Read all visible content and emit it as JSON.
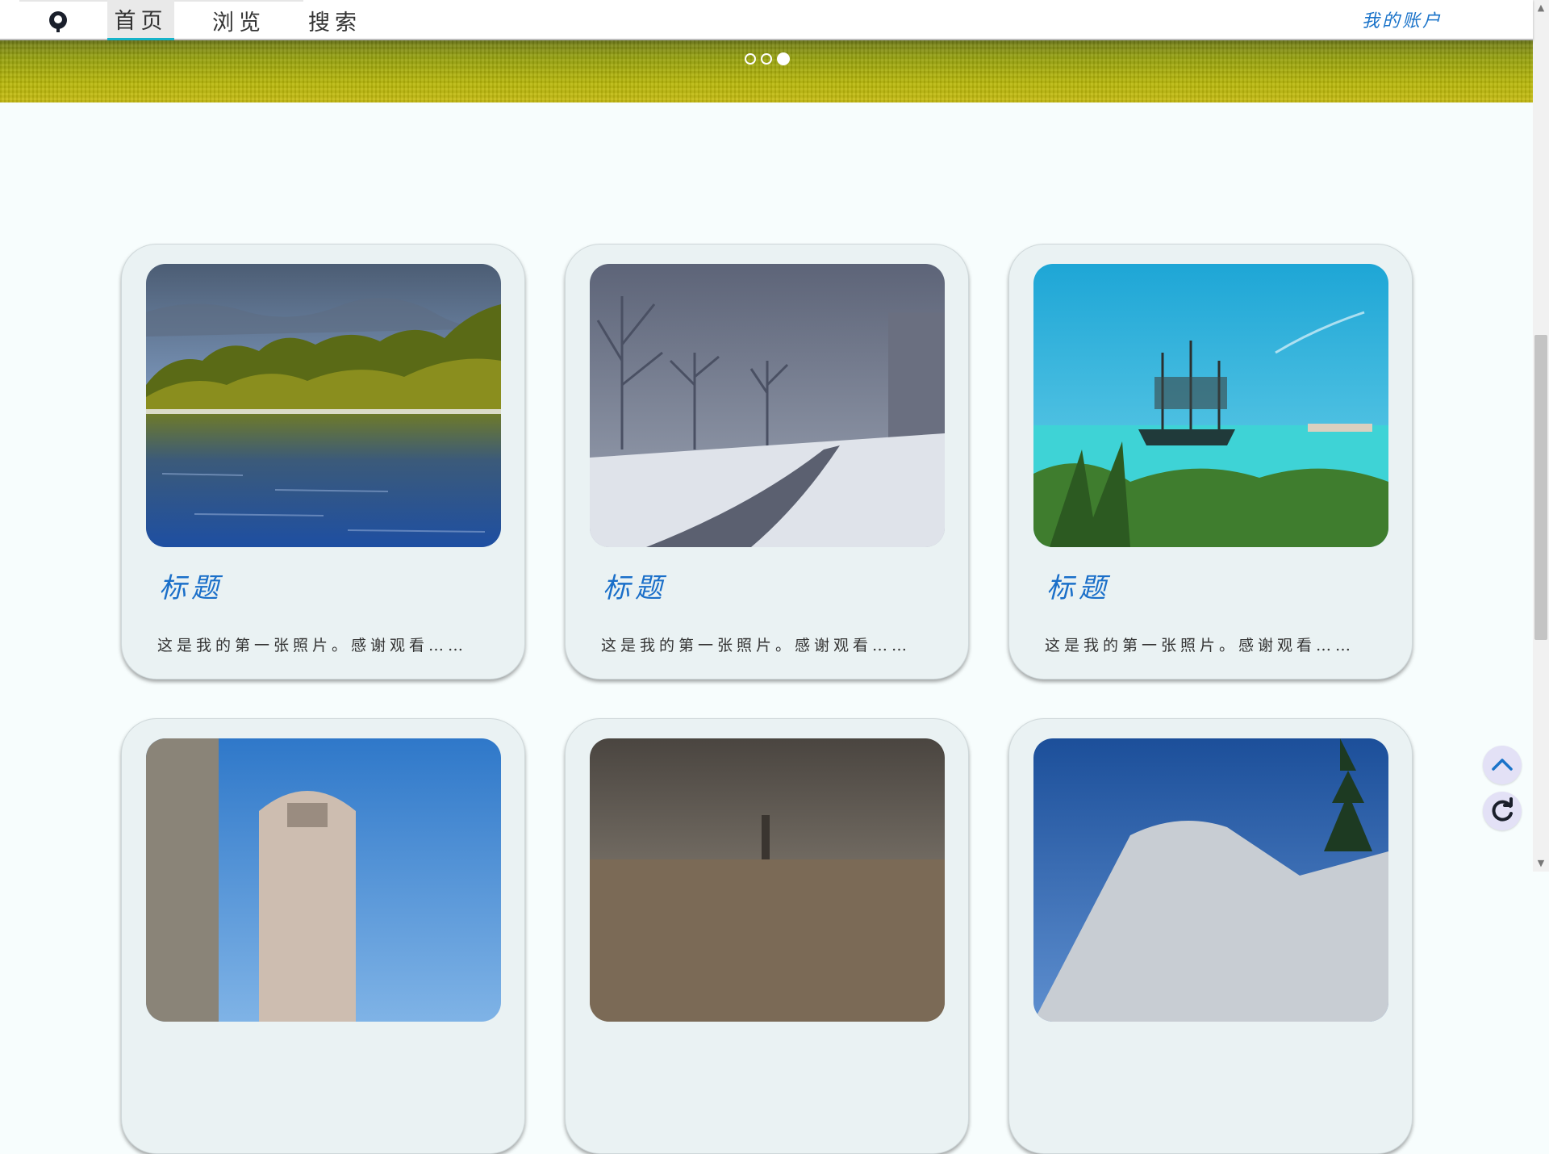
{
  "nav": {
    "tabs": [
      {
        "label": "首页",
        "active": true
      },
      {
        "label": "浏览",
        "active": false
      },
      {
        "label": "搜索",
        "active": false
      }
    ],
    "account_label": "我的账户",
    "accent_color": "#16b3c9",
    "link_color": "#1a73c9"
  },
  "carousel": {
    "slide_count": 3,
    "active_index": 2
  },
  "cards": [
    {
      "title": "标题",
      "text": "这是我的第一张照片。感谢观看……",
      "image": "lake-forest-photo"
    },
    {
      "title": "标题",
      "text": "这是我的第一张照片。感谢观看……",
      "image": "snowy-path-photo"
    },
    {
      "title": "标题",
      "text": "这是我的第一张照片。感谢观看……",
      "image": "pirate-ship-beach-photo"
    },
    {
      "title": "",
      "text": "",
      "image": "cathedral-photo"
    },
    {
      "title": "",
      "text": "",
      "image": "city-obelisk-photo"
    },
    {
      "title": "",
      "text": "",
      "image": "snowy-mountain-photo"
    }
  ],
  "floating_buttons": {
    "top": "chevron-up-icon",
    "refresh": "refresh-icon"
  }
}
